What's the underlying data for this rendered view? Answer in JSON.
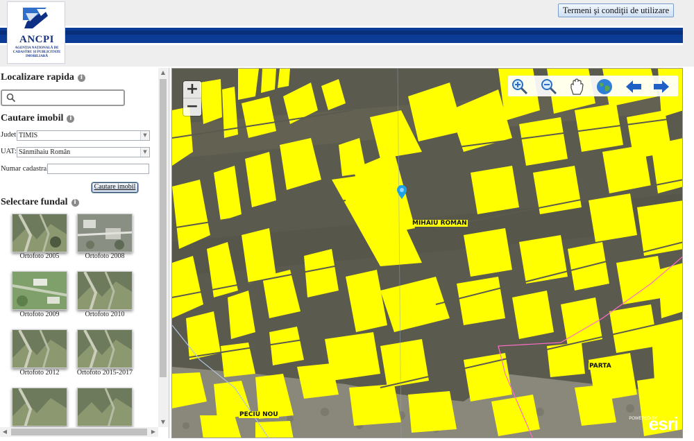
{
  "header": {
    "logo_text": "ANCPI",
    "logo_subtitle": "AGENȚIA NAȚIONALĂ DE CADASTRU ȘI PUBLICITATE IMOBILIARĂ",
    "terms_button": "Termeni şi condiţii de utilizare"
  },
  "sidebar": {
    "quick_locate": {
      "title": "Localizare rapida",
      "search_value": ""
    },
    "property_search": {
      "title": "Cautare imobil",
      "county_label": "Judet:",
      "county_value": "TIMIS",
      "uat_label": "UAT:",
      "uat_value": "Sânmihaiu Român",
      "cadastral_label": "Numar cadastral:",
      "cadastral_value": "",
      "search_button": "Cautare imobil"
    },
    "basemap": {
      "title": "Selectare fundal",
      "items": [
        {
          "label": "Ortofoto 2005"
        },
        {
          "label": "Ortofoto 2008"
        },
        {
          "label": "Ortofoto 2009"
        },
        {
          "label": "Ortofoto 2010"
        },
        {
          "label": "Ortofoto 2012"
        },
        {
          "label": "Ortofoto 2015-2017"
        },
        {
          "label": ""
        },
        {
          "label": ""
        }
      ]
    }
  },
  "map": {
    "zoom_in": "+",
    "zoom_out": "−",
    "tools": [
      "zoom-in-icon",
      "zoom-out-icon",
      "pan-hand-icon",
      "full-extent-globe-icon",
      "previous-extent-icon",
      "next-extent-icon"
    ],
    "labels": {
      "town1": "MIHAIU ROMAN",
      "town2": "PARTA",
      "town3": "PECIU NOU"
    },
    "attribution": {
      "powered_by": "POWERED BY",
      "brand": "esri"
    },
    "colors": {
      "parcel": "#ffff00",
      "land": "#5b5a4e",
      "boundary": "#ff6ec7"
    }
  }
}
